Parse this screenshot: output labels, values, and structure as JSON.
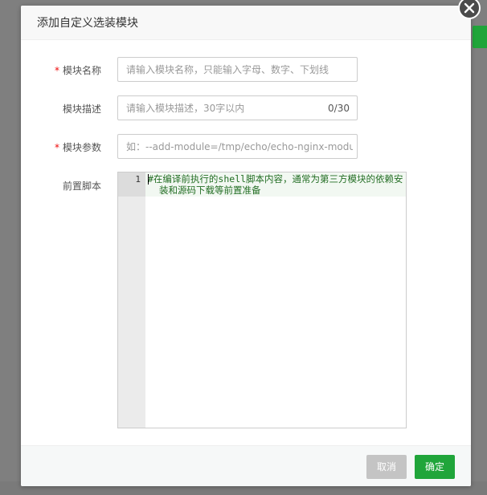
{
  "dialog": {
    "title": "添加自定义选装模块",
    "close_icon": "close-icon"
  },
  "form": {
    "module_name": {
      "label": "模块名称",
      "required_mark": "*",
      "placeholder": "请输入模块名称，只能输入字母、数字、下划线"
    },
    "module_desc": {
      "label": "模块描述",
      "placeholder": "请输入模块描述，30字以内",
      "counter": "0/30"
    },
    "module_params": {
      "label": "模块参数",
      "required_mark": "*",
      "placeholder": "如：--add-module=/tmp/echo/echo-nginx-module-master"
    },
    "pre_script": {
      "label": "前置脚本",
      "line_number": "1",
      "code": "#在编译前执行的shell脚本内容，通常为第三方模块的依赖安装和源码下载等前置准备"
    }
  },
  "footer": {
    "cancel_label": "取消",
    "confirm_label": "确定"
  },
  "colors": {
    "accent": "#20a53a",
    "required": "#ef0808",
    "comment": "#236e24"
  }
}
